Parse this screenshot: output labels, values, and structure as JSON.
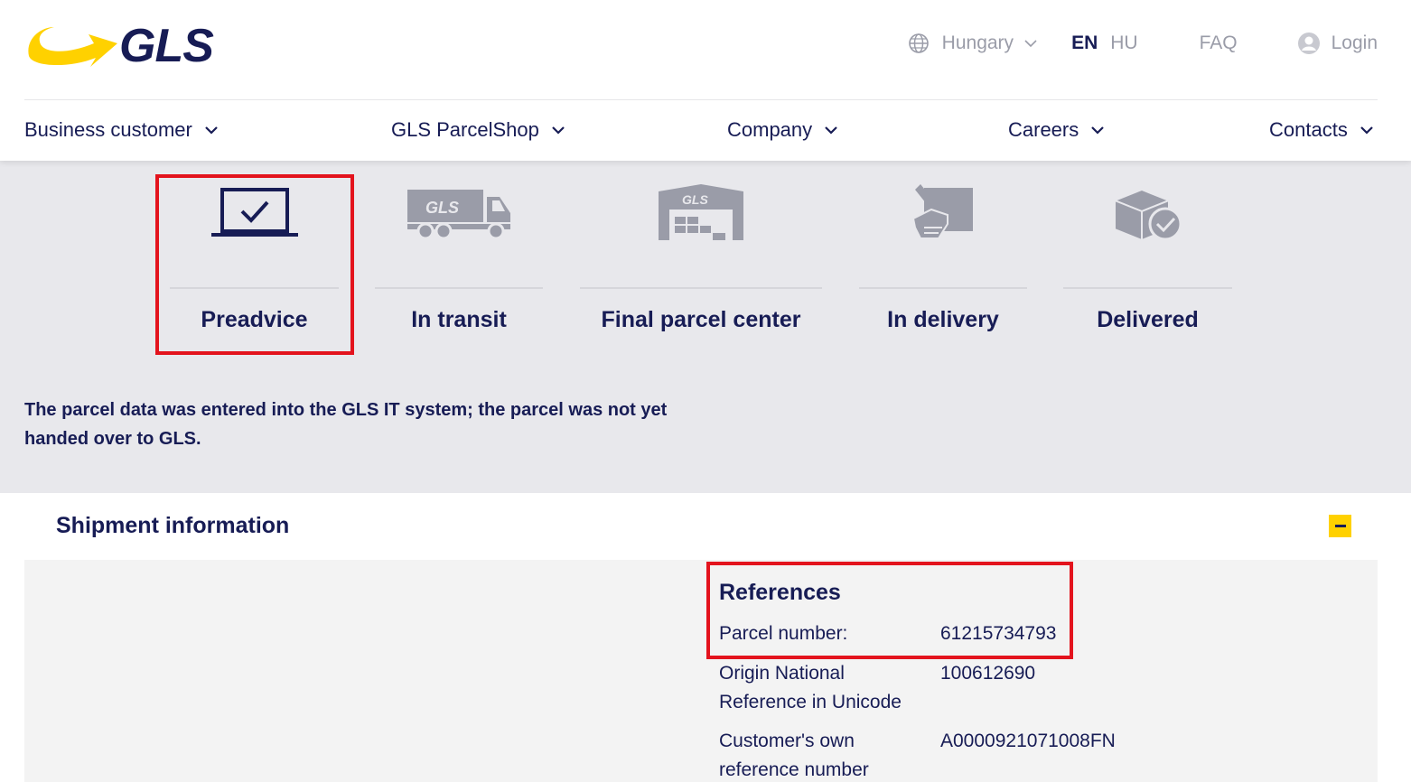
{
  "brand": {
    "logo_text": "GLS"
  },
  "topbar": {
    "country": "Hungary",
    "lang_en": "EN",
    "lang_hu": "HU",
    "faq": "FAQ",
    "login": "Login"
  },
  "nav": {
    "items": [
      {
        "label": "Business customer"
      },
      {
        "label": "GLS ParcelShop"
      },
      {
        "label": "Company"
      },
      {
        "label": "Careers"
      },
      {
        "label": "Contacts"
      }
    ]
  },
  "tracking": {
    "steps": [
      {
        "label": "Preadvice",
        "icon": "laptop-check-icon",
        "active": true
      },
      {
        "label": "In transit",
        "icon": "truck-icon",
        "active": false
      },
      {
        "label": "Final parcel center",
        "icon": "warehouse-icon",
        "active": false
      },
      {
        "label": "In delivery",
        "icon": "hand-parcel-icon",
        "active": false
      },
      {
        "label": "Delivered",
        "icon": "parcel-check-icon",
        "active": false
      }
    ],
    "status_description": "The parcel data was entered into the GLS IT system; the parcel was not yet handed over to GLS."
  },
  "shipment": {
    "title": "Shipment information",
    "references_title": "References",
    "rows": [
      {
        "key": "Parcel number:",
        "value": "61215734793"
      },
      {
        "key": "Origin National Reference in Unicode",
        "value": "100612690"
      },
      {
        "key": "Customer's own reference number",
        "value": "A0000921071008FN"
      }
    ]
  },
  "colors": {
    "brand_yellow": "#ffd100",
    "brand_navy": "#171c55",
    "highlight_red": "#e3131d",
    "status_bg": "#e8e8ec",
    "inactive_icon": "#9a9ca8"
  }
}
